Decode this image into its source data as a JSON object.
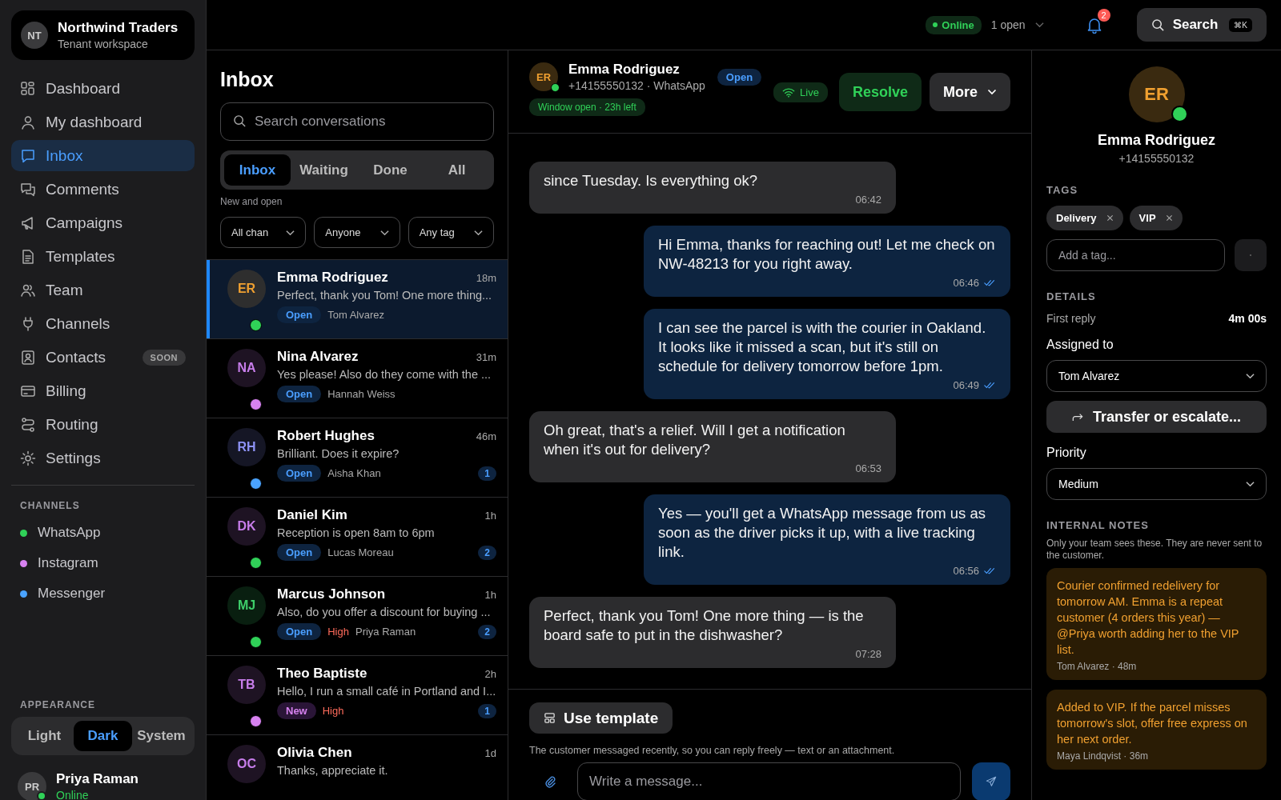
{
  "workspace": {
    "initials": "NT",
    "name": "Northwind Traders",
    "subtitle": "Tenant workspace"
  },
  "nav": [
    {
      "kind": "grid",
      "label": "Dashboard",
      "selected": false
    },
    {
      "kind": "person",
      "label": "My dashboard",
      "selected": false
    },
    {
      "kind": "bubble",
      "label": "Inbox",
      "selected": true
    },
    {
      "kind": "bubbles",
      "label": "Comments",
      "selected": false
    },
    {
      "kind": "megaphone",
      "label": "Campaigns",
      "selected": false
    },
    {
      "kind": "document",
      "label": "Templates",
      "selected": false
    },
    {
      "kind": "people",
      "label": "Team",
      "selected": false
    },
    {
      "kind": "plug",
      "label": "Channels",
      "selected": false
    },
    {
      "kind": "contact",
      "label": "Contacts",
      "selected": false,
      "badge": "SOON"
    },
    {
      "kind": "card",
      "label": "Billing",
      "selected": false
    },
    {
      "kind": "route",
      "label": "Routing",
      "selected": false
    },
    {
      "kind": "gear",
      "label": "Settings",
      "selected": false
    }
  ],
  "channels": {
    "heading": "CHANNELS",
    "items": [
      {
        "name": "WhatsApp",
        "color": "#30d158"
      },
      {
        "name": "Instagram",
        "color": "#d782f0"
      },
      {
        "name": "Messenger",
        "color": "#4aa3ff"
      }
    ]
  },
  "appearance": {
    "heading": "APPEARANCE",
    "options": [
      {
        "label": "Light",
        "selected": false
      },
      {
        "label": "Dark",
        "selected": true
      },
      {
        "label": "System",
        "selected": false
      }
    ]
  },
  "user": {
    "initials": "PR",
    "name": "Priya Raman",
    "status": "Online",
    "online": true
  },
  "topbar": {
    "presence": "Online",
    "open_count": "1 open",
    "notifications": "2",
    "search": "Search",
    "shortcut": "⌘K"
  },
  "inbox": {
    "title": "Inbox",
    "search_placeholder": "Search conversations",
    "tabs": [
      {
        "label": "Inbox",
        "selected": true
      },
      {
        "label": "Waiting",
        "selected": false
      },
      {
        "label": "Done",
        "selected": false
      },
      {
        "label": "All",
        "selected": false
      }
    ],
    "tab_hint": "New and open",
    "filters": [
      "All chan",
      "Anyone",
      "Any tag"
    ]
  },
  "conversations": [
    {
      "avatar": {
        "initials": "ER",
        "color": "#f0a030"
      },
      "channel": {
        "color": "#30d158"
      },
      "name": "Emma Rodriguez",
      "time": "18m",
      "preview": "Perfect, thank you Tom! One more thing...",
      "status": {
        "kind": "open",
        "label": "Open"
      },
      "agent": "Tom Alvarez",
      "selected": true
    },
    {
      "avatar": {
        "initials": "NA",
        "color": "#c77dea"
      },
      "channel": {
        "color": "#d782f0"
      },
      "name": "Nina Alvarez",
      "time": "31m",
      "preview": "Yes please! Also do they come with the ...",
      "status": {
        "kind": "open",
        "label": "Open"
      },
      "agent": "Hannah Weiss",
      "selected": false
    },
    {
      "avatar": {
        "initials": "RH",
        "color": "#8e92f5"
      },
      "channel": {
        "color": "#4aa3ff"
      },
      "name": "Robert Hughes",
      "time": "46m",
      "preview": "Brilliant. Does it expire?",
      "status": {
        "kind": "open",
        "label": "Open"
      },
      "agent": "Aisha Khan",
      "unread": "1",
      "selected": false
    },
    {
      "avatar": {
        "initials": "DK",
        "color": "#c77dea"
      },
      "channel": {
        "color": "#30d158"
      },
      "name": "Daniel Kim",
      "time": "1h",
      "preview": "Reception is open 8am to 6pm",
      "status": {
        "kind": "open",
        "label": "Open"
      },
      "agent": "Lucas Moreau",
      "unread": "2",
      "selected": false
    },
    {
      "avatar": {
        "initials": "MJ",
        "color": "#3ecf6a"
      },
      "channel": {
        "color": "#30d158"
      },
      "name": "Marcus Johnson",
      "time": "1h",
      "preview": "Also, do you offer a discount for buying ...",
      "status": {
        "kind": "open",
        "label": "Open"
      },
      "priority": "High",
      "agent": "Priya Raman",
      "unread": "2",
      "selected": false
    },
    {
      "avatar": {
        "initials": "TB",
        "color": "#c77dea"
      },
      "channel": {
        "color": "#d782f0"
      },
      "name": "Theo Baptiste",
      "time": "2h",
      "preview": "Hello, I run a small café in Portland and I...",
      "status": {
        "kind": "new",
        "label": "New"
      },
      "priority": "High",
      "unread": "1",
      "selected": false
    },
    {
      "avatar": {
        "initials": "OC",
        "color": "#c77dea"
      },
      "name": "Olivia Chen",
      "time": "1d",
      "preview": "Thanks, appreciate it.",
      "selected": false
    }
  ],
  "chat": {
    "contact": {
      "initials": "ER",
      "name": "Emma Rodriguez",
      "subtitle": "+14155550132 · WhatsApp",
      "status": "Open",
      "online": true
    },
    "window_note": "Window open · 23h left",
    "live": "Live",
    "resolve": "Resolve",
    "more": "More",
    "messages": [
      {
        "kind": "in",
        "text": "since Tuesday. Is everything ok?",
        "time": "06:42",
        "read": false
      },
      {
        "kind": "out",
        "text": "Hi Emma, thanks for reaching out! Let me check on NW-48213 for you right away.",
        "time": "06:46",
        "read": true
      },
      {
        "kind": "out",
        "text": "I can see the parcel is with the courier in Oakland. It looks like it missed a scan, but it's still on schedule for delivery tomorrow before 1pm.",
        "time": "06:49",
        "read": true
      },
      {
        "kind": "in",
        "text": "Oh great, that's a relief. Will I get a notification when it's out for delivery?",
        "time": "06:53",
        "read": false
      },
      {
        "kind": "out",
        "text": "Yes — you'll get a WhatsApp message from us as soon as the driver picks it up, with a live tracking link.",
        "time": "06:56",
        "read": true
      },
      {
        "kind": "in",
        "text": "Perfect, thank you Tom! One more thing — is the board safe to put in the dishwasher?",
        "time": "07:28",
        "read": false
      }
    ],
    "template_button": "Use template",
    "hint": "The customer messaged recently, so you can reply freely — text or an attachment.",
    "composer_placeholder": "Write a message..."
  },
  "details": {
    "initials": "ER",
    "name": "Emma Rodriguez",
    "phone": "+14155550132",
    "online": true,
    "tags_heading": "TAGS",
    "tags": [
      "Delivery",
      "VIP"
    ],
    "tag_placeholder": "Add a tag...",
    "details_heading": "DETAILS",
    "first_reply_label": "First reply",
    "first_reply": "4m 00s",
    "assigned_label": "Assigned to",
    "assigned": "Tom Alvarez",
    "transfer": "Transfer or escalate...",
    "priority_label": "Priority",
    "priority": "Medium",
    "notes_heading": "INTERNAL NOTES",
    "notes_hint": "Only your team sees these. They are never sent to the customer.",
    "notes": [
      {
        "text": "Courier confirmed redelivery for tomorrow AM. Emma is a repeat customer (4 orders this year) — @Priya worth adding her to the VIP list.",
        "meta": "Tom Alvarez · 48m"
      },
      {
        "text": "Added to VIP. If the parcel misses tomorrow's slot, offer free express on her next order.",
        "meta": "Maya Lindqvist · 36m"
      }
    ]
  }
}
